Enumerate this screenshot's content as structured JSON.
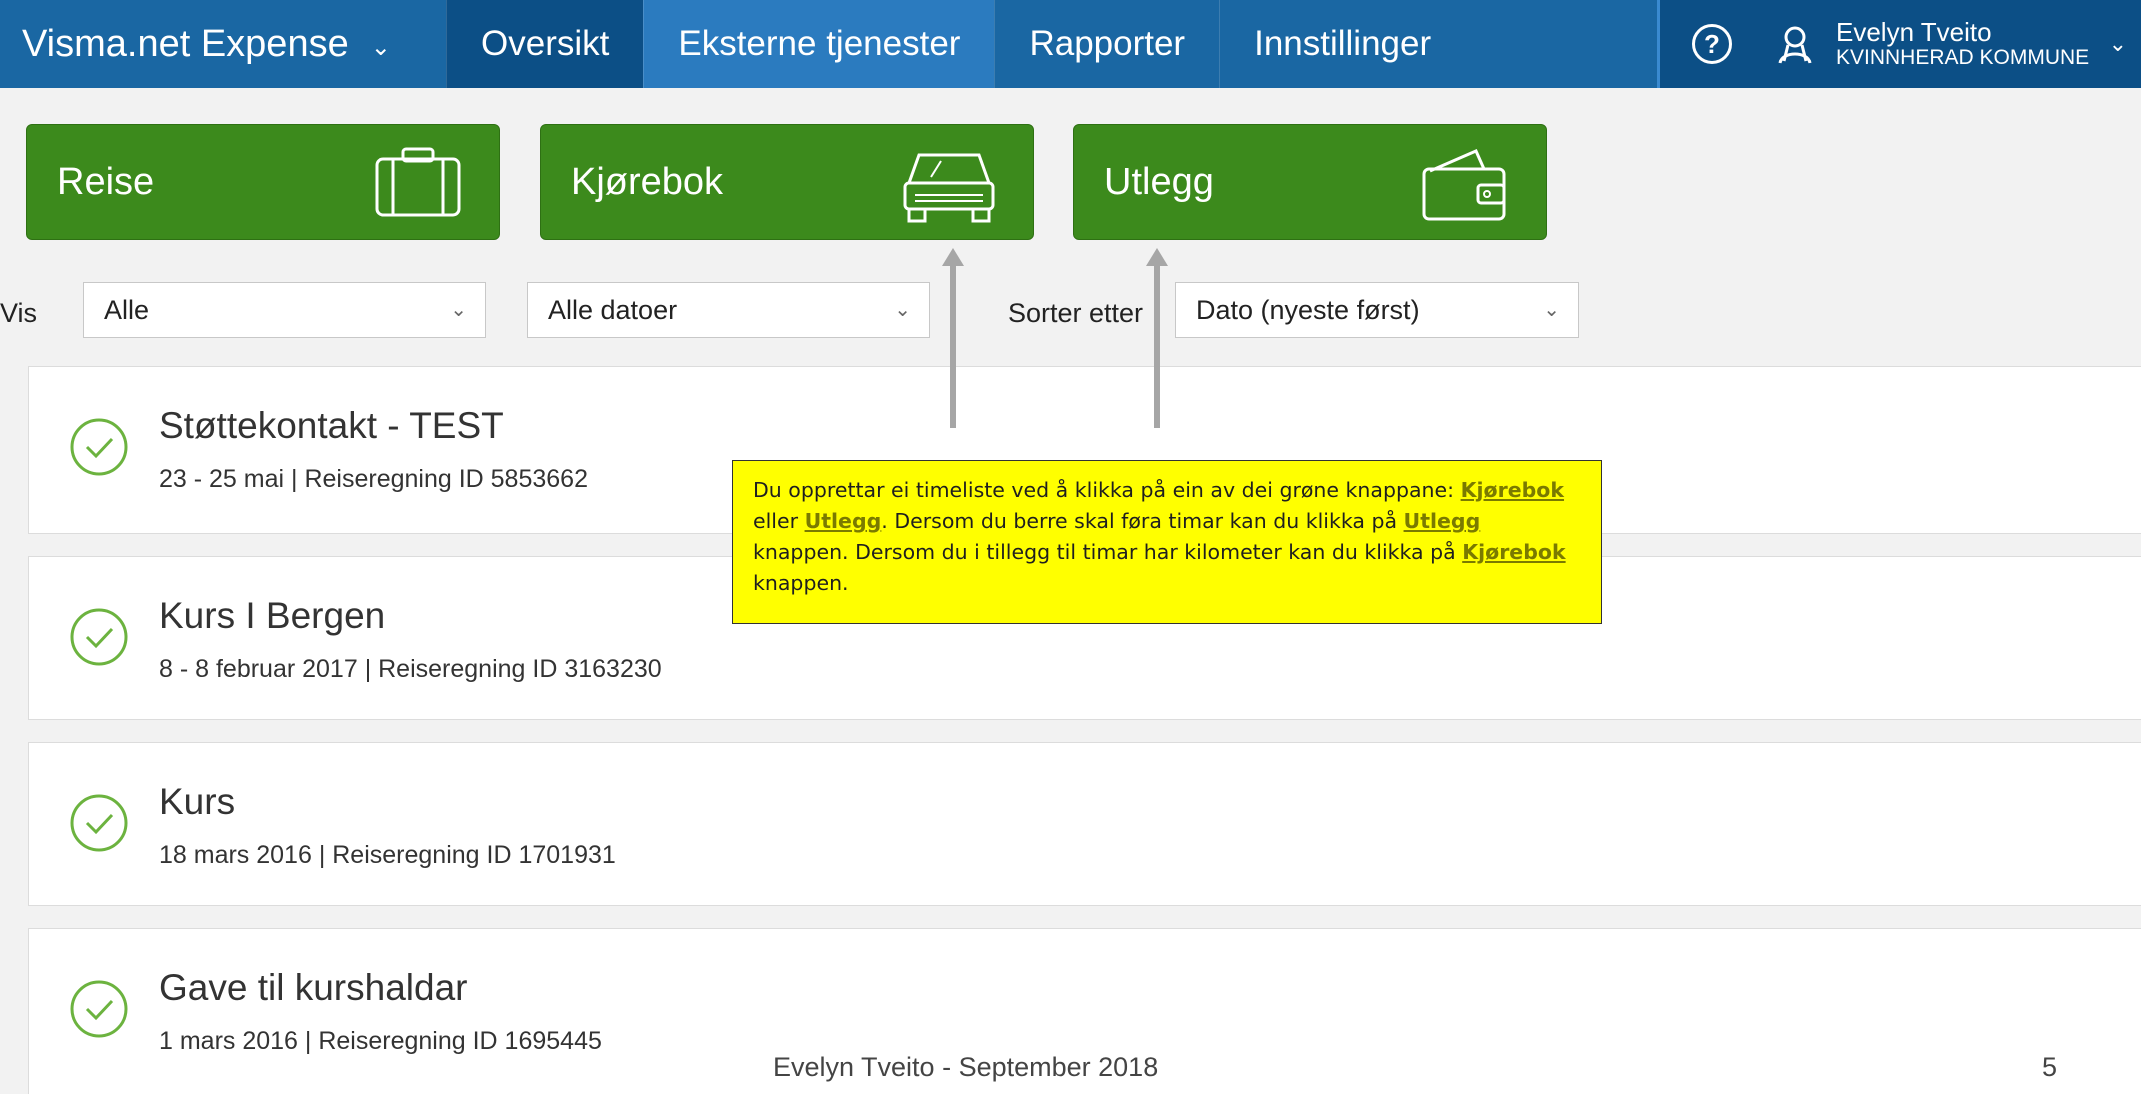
{
  "nav": {
    "brand": "Visma.net Expense",
    "items": [
      "Oversikt",
      "Eksterne tjenester",
      "Rapporter",
      "Innstillinger"
    ],
    "user_name": "Evelyn Tveito",
    "user_org": "KVINNHERAD KOMMUNE"
  },
  "actions": {
    "reise": "Reise",
    "kjorebok": "Kjørebok",
    "utlegg": "Utlegg"
  },
  "filters": {
    "vis_label": "Vis",
    "vis_value": "Alle",
    "dates_value": "Alle datoer",
    "sort_label": "Sorter etter",
    "sort_value": "Dato (nyeste først)"
  },
  "items": [
    {
      "title": "Støttekontakt - TEST",
      "sub": "23 - 25 mai | Reiseregning ID 5853662"
    },
    {
      "title": "Kurs I Bergen",
      "sub": "8 - 8 februar 2017 | Reiseregning ID 3163230"
    },
    {
      "title": "Kurs",
      "sub": "18 mars 2016 | Reiseregning ID 1701931"
    },
    {
      "title": "Gave til kurshaldar",
      "sub": "1 mars 2016 | Reiseregning ID 1695445"
    }
  ],
  "callout": {
    "p1": "Du opprettar ei timeliste ved å klikka på ein av dei grøne knappane:",
    "k1": "Kjørebok",
    "p2": " eller ",
    "u1": "Utlegg",
    "p3": ". Dersom du berre skal føra timar kan du klikka på ",
    "u2": "Utlegg",
    "p4": " knappen. Dersom du i tillegg til timar har kilometer kan du klikka på ",
    "k2": "Kjørebok",
    "p5": " knappen."
  },
  "footer": {
    "text": "Evelyn Tveito - September 2018",
    "page": "5"
  },
  "colors": {
    "nav_blue": "#1a67a3",
    "action_green": "#3c8a1c",
    "callout_yellow": "#ffff00",
    "check_green": "#6cb33f"
  }
}
